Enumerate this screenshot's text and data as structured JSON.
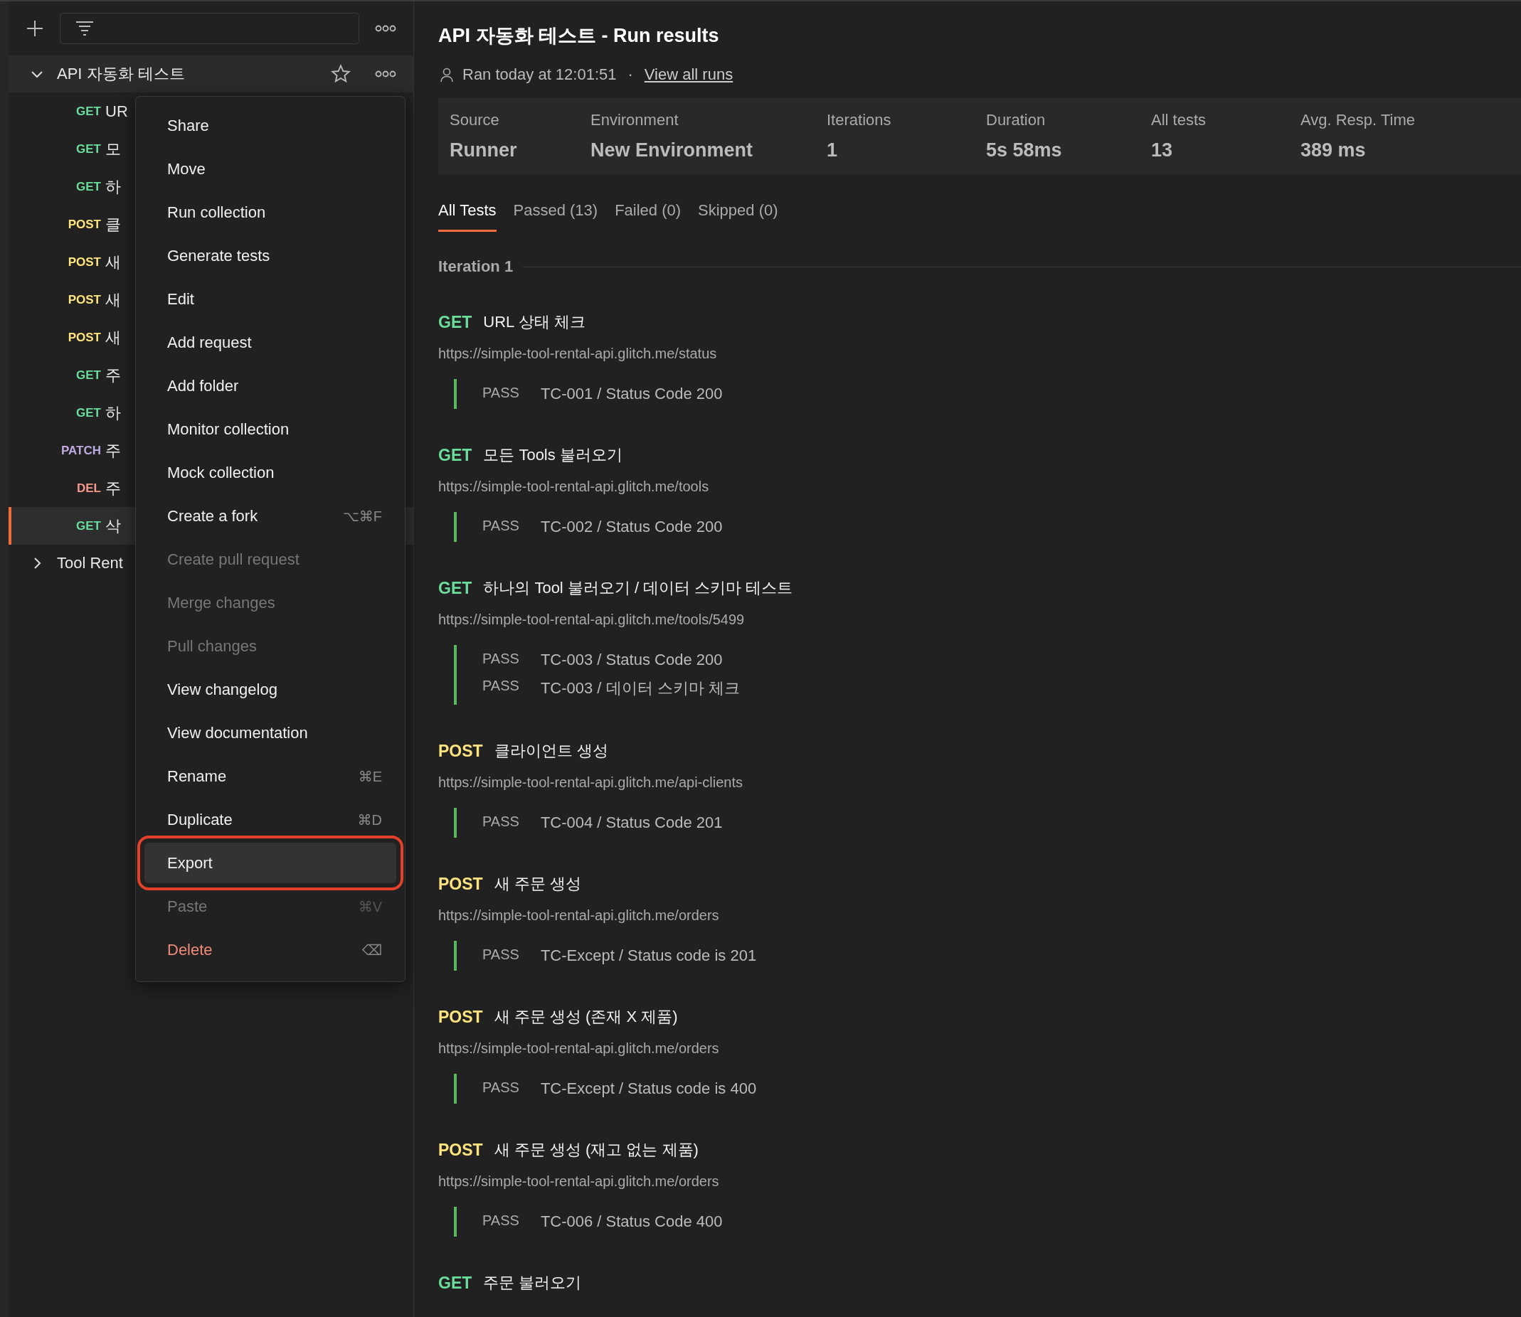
{
  "sidebar": {
    "collections": [
      {
        "name": "API 자동화 테스트",
        "expanded": true,
        "starred": false,
        "children": [
          {
            "method": "GET",
            "name": "UR",
            "selected": false
          },
          {
            "method": "GET",
            "name": "모",
            "selected": false
          },
          {
            "method": "GET",
            "name": "하",
            "selected": false
          },
          {
            "method": "POST",
            "name": "클",
            "selected": false
          },
          {
            "method": "POST",
            "name": "새",
            "selected": false
          },
          {
            "method": "POST",
            "name": "새",
            "selected": false
          },
          {
            "method": "POST",
            "name": "새",
            "selected": false
          },
          {
            "method": "GET",
            "name": "주",
            "selected": false
          },
          {
            "method": "GET",
            "name": "하",
            "selected": false
          },
          {
            "method": "PATCH",
            "name": "주",
            "selected": false
          },
          {
            "method": "DEL",
            "name": "주",
            "selected": false
          },
          {
            "method": "GET",
            "name": "삭",
            "selected": true
          }
        ]
      },
      {
        "name": "Tool Rent",
        "expanded": false
      }
    ]
  },
  "context_menu": {
    "items": [
      {
        "label": "Share",
        "kind": "normal",
        "selected": false
      },
      {
        "label": "Move",
        "kind": "normal",
        "selected": false
      },
      {
        "label": "Run collection",
        "kind": "normal",
        "selected": false
      },
      {
        "label": "Generate tests",
        "kind": "normal",
        "selected": false
      },
      {
        "label": "Edit",
        "kind": "normal",
        "selected": false
      },
      {
        "label": "Add request",
        "kind": "normal",
        "selected": false
      },
      {
        "label": "Add folder",
        "kind": "normal",
        "selected": false
      },
      {
        "label": "Monitor collection",
        "kind": "normal",
        "selected": false
      },
      {
        "label": "Mock collection",
        "kind": "normal",
        "selected": false
      },
      {
        "label": "Create a fork",
        "kind": "normal",
        "shortcut": "⌥⌘F",
        "selected": false
      },
      {
        "label": "Create pull request",
        "kind": "disabled",
        "selected": false
      },
      {
        "label": "Merge changes",
        "kind": "disabled",
        "selected": false
      },
      {
        "label": "Pull changes",
        "kind": "disabled",
        "selected": false
      },
      {
        "label": "View changelog",
        "kind": "normal",
        "selected": false
      },
      {
        "label": "View documentation",
        "kind": "normal",
        "selected": false
      },
      {
        "label": "Rename",
        "kind": "normal",
        "shortcut": "⌘E",
        "selected": false
      },
      {
        "label": "Duplicate",
        "kind": "normal",
        "shortcut": "⌘D",
        "selected": false
      },
      {
        "label": "Export",
        "kind": "normal",
        "selected": true
      },
      {
        "label": "Paste",
        "kind": "disabled",
        "shortcut": "⌘V",
        "selected": false
      },
      {
        "label": "Delete",
        "kind": "danger",
        "shortcut": "⌫",
        "selected": false
      }
    ]
  },
  "results": {
    "title": "API 자동화 테스트 - Run results",
    "ran": "Ran today at 12:01:51",
    "separator": "·",
    "view_all": "View all runs",
    "stats": [
      {
        "label": "Source",
        "value": "Runner"
      },
      {
        "label": "Environment",
        "value": "New Environment"
      },
      {
        "label": "Iterations",
        "value": "1"
      },
      {
        "label": "Duration",
        "value": "5s 58ms"
      },
      {
        "label": "All tests",
        "value": "13"
      },
      {
        "label": "Avg. Resp. Time",
        "value": "389 ms"
      }
    ],
    "tabs": [
      {
        "label": "All Tests",
        "selected": true
      },
      {
        "label": "Passed (13)",
        "selected": false
      },
      {
        "label": "Failed (0)",
        "selected": false
      },
      {
        "label": "Skipped (0)",
        "selected": false
      }
    ],
    "iteration": "Iteration 1",
    "requests": [
      {
        "method": "GET",
        "name": "URL 상태 체크",
        "url": "https://simple-tool-rental-api.glitch.me/status",
        "tests": [
          {
            "status": "PASS",
            "name": "TC-001 / Status Code 200"
          }
        ]
      },
      {
        "method": "GET",
        "name": "모든 Tools 불러오기",
        "url": "https://simple-tool-rental-api.glitch.me/tools",
        "tests": [
          {
            "status": "PASS",
            "name": "TC-002 / Status Code 200"
          }
        ]
      },
      {
        "method": "GET",
        "name": "하나의 Tool 불러오기 / 데이터 스키마 테스트",
        "url": "https://simple-tool-rental-api.glitch.me/tools/5499",
        "tests": [
          {
            "status": "PASS",
            "name": "TC-003 / Status Code 200"
          },
          {
            "status": "PASS",
            "name": "TC-003 / 데이터 스키마 체크"
          }
        ]
      },
      {
        "method": "POST",
        "name": "클라이언트 생성",
        "url": "https://simple-tool-rental-api.glitch.me/api-clients",
        "tests": [
          {
            "status": "PASS",
            "name": "TC-004 / Status Code 201"
          }
        ]
      },
      {
        "method": "POST",
        "name": "새 주문 생성",
        "url": "https://simple-tool-rental-api.glitch.me/orders",
        "tests": [
          {
            "status": "PASS",
            "name": "TC-Except / Status code is 201"
          }
        ]
      },
      {
        "method": "POST",
        "name": "새 주문 생성 (존재 X 제품)",
        "url": "https://simple-tool-rental-api.glitch.me/orders",
        "tests": [
          {
            "status": "PASS",
            "name": "TC-Except / Status code is 400"
          }
        ]
      },
      {
        "method": "POST",
        "name": "새 주문 생성 (재고 없는 제품)",
        "url": "https://simple-tool-rental-api.glitch.me/orders",
        "tests": [
          {
            "status": "PASS",
            "name": "TC-006 / Status Code 400"
          }
        ]
      },
      {
        "method": "GET",
        "name": "주문 불러오기"
      }
    ]
  }
}
